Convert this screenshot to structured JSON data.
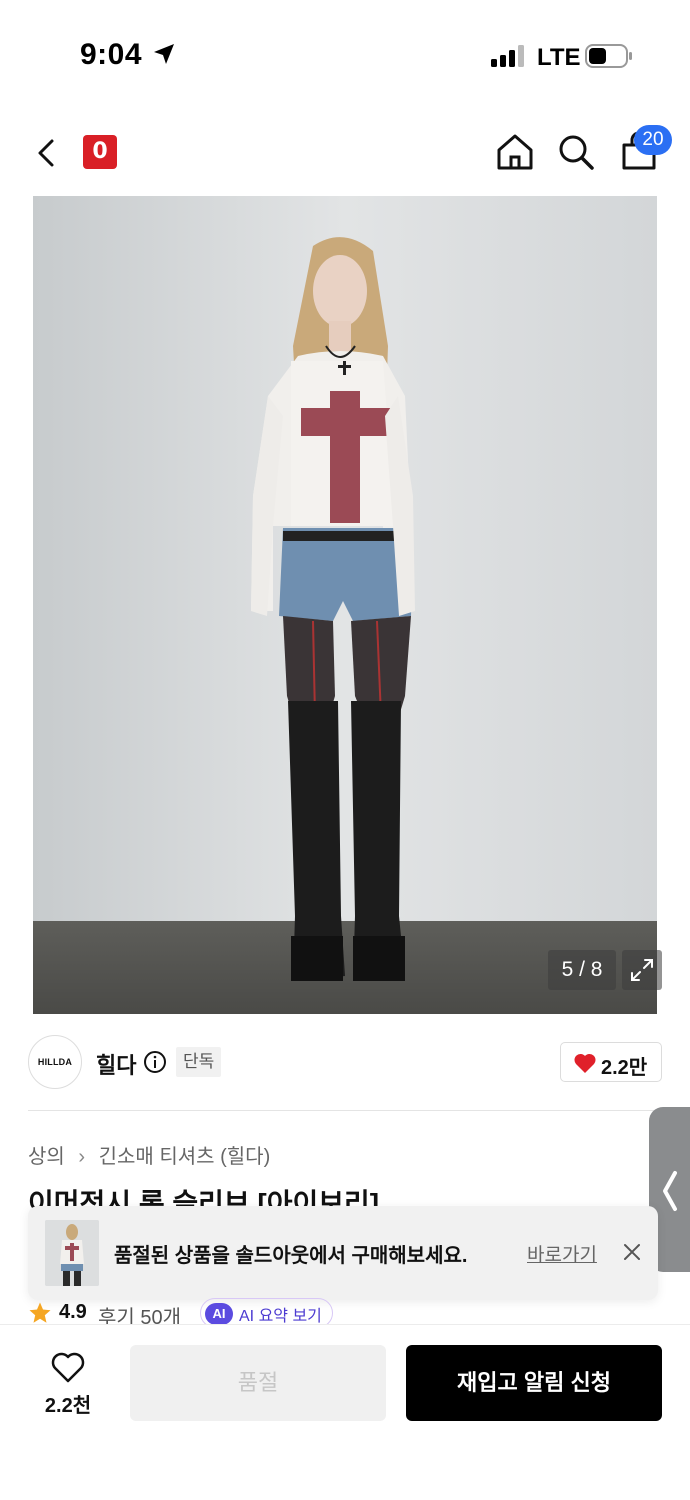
{
  "status_bar": {
    "time": "9:04",
    "carrier": "LTE"
  },
  "nav": {
    "brand_logo": "0",
    "cart_count": "20"
  },
  "gallery": {
    "counter": "5 / 8"
  },
  "brand": {
    "avatar_text": "HILLDA",
    "name": "힐다",
    "exclusive_label": "단독",
    "like_count": "2.2만"
  },
  "breadcrumb": {
    "category": "상의",
    "subcategory": "긴소매 티셔츠 (힐다)"
  },
  "product": {
    "title": "이머전시 롱 슬리브 [아이보리]"
  },
  "banner": {
    "message": "품절된 상품을 솔드아웃에서 구매해보세요.",
    "link_label": "바로가기"
  },
  "rating": {
    "score": "4.9",
    "review_label": "후기 50개",
    "ai_badge": "AI",
    "ai_summary_label": "AI 요약 보기"
  },
  "bottom_bar": {
    "wish_count": "2.2천",
    "soldout_label": "품절",
    "restock_label": "재입고 알림 신청"
  },
  "colors": {
    "brand_red": "#d91f26",
    "badge_blue": "#2b6ff3",
    "heart_red": "#e0202a",
    "star_orange": "#f5a623",
    "ai_purple": "#5b4be0"
  }
}
